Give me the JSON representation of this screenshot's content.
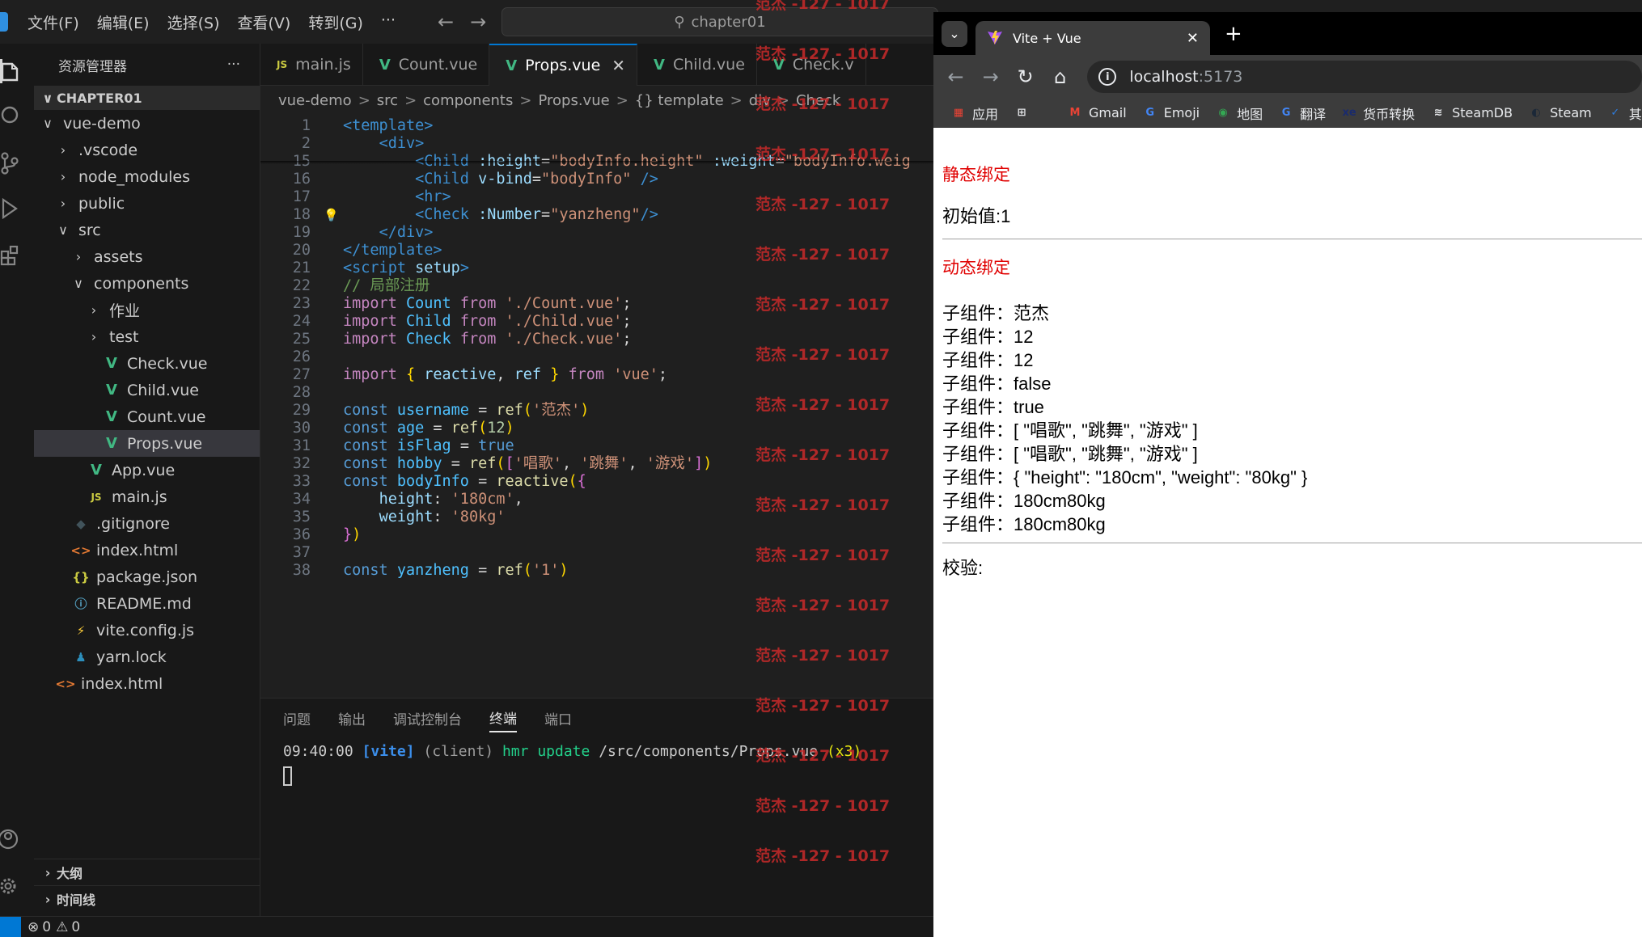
{
  "vscode": {
    "menu": [
      "文件(F)",
      "编辑(E)",
      "选择(S)",
      "查看(V)",
      "转到(G)",
      "···"
    ],
    "search_text": "chapter01",
    "explorer_title": "资源管理器",
    "explorer_more": "···",
    "section_title": "CHAPTER01",
    "tree": [
      {
        "label": "vue-demo",
        "chev": "∨",
        "indent": 0,
        "icon": "",
        "kind": "folder"
      },
      {
        "label": ".vscode",
        "chev": "›",
        "indent": 1,
        "icon": "",
        "kind": "folder"
      },
      {
        "label": "node_modules",
        "chev": "›",
        "indent": 1,
        "icon": "",
        "kind": "folder"
      },
      {
        "label": "public",
        "chev": "›",
        "indent": 1,
        "icon": "",
        "kind": "folder"
      },
      {
        "label": "src",
        "chev": "∨",
        "indent": 1,
        "icon": "",
        "kind": "folder"
      },
      {
        "label": "assets",
        "chev": "›",
        "indent": 2,
        "icon": "",
        "kind": "folder"
      },
      {
        "label": "components",
        "chev": "∨",
        "indent": 2,
        "icon": "",
        "kind": "folder"
      },
      {
        "label": "作业",
        "chev": "›",
        "indent": 3,
        "icon": "",
        "kind": "folder"
      },
      {
        "label": "test",
        "chev": "›",
        "indent": 3,
        "icon": "",
        "kind": "folder"
      },
      {
        "label": "Check.vue",
        "chev": "",
        "indent": 3,
        "icon": "V",
        "kind": "vue"
      },
      {
        "label": "Child.vue",
        "chev": "",
        "indent": 3,
        "icon": "V",
        "kind": "vue"
      },
      {
        "label": "Count.vue",
        "chev": "",
        "indent": 3,
        "icon": "V",
        "kind": "vue"
      },
      {
        "label": "Props.vue",
        "chev": "",
        "indent": 3,
        "icon": "V",
        "kind": "vue",
        "selected": true
      },
      {
        "label": "App.vue",
        "chev": "",
        "indent": 2,
        "icon": "V",
        "kind": "vue"
      },
      {
        "label": "main.js",
        "chev": "",
        "indent": 2,
        "icon": "JS",
        "kind": "js"
      },
      {
        "label": ".gitignore",
        "chev": "",
        "indent": 1,
        "icon": "◆",
        "kind": "git"
      },
      {
        "label": "index.html",
        "chev": "",
        "indent": 1,
        "icon": "<>",
        "kind": "html"
      },
      {
        "label": "package.json",
        "chev": "",
        "indent": 1,
        "icon": "{}",
        "kind": "json"
      },
      {
        "label": "README.md",
        "chev": "",
        "indent": 1,
        "icon": "ⓘ",
        "kind": "md"
      },
      {
        "label": "vite.config.js",
        "chev": "",
        "indent": 1,
        "icon": "⚡",
        "kind": "vite"
      },
      {
        "label": "yarn.lock",
        "chev": "",
        "indent": 1,
        "icon": "♟",
        "kind": "yarn"
      },
      {
        "label": "index.html",
        "chev": "",
        "indent": 0,
        "icon": "<>",
        "kind": "html"
      }
    ],
    "outline_label": "大纲",
    "timeline_label": "时间线",
    "tabs": [
      {
        "label": "main.js",
        "icon": "JS",
        "kind": "js"
      },
      {
        "label": "Count.vue",
        "icon": "V",
        "kind": "vue"
      },
      {
        "label": "Props.vue",
        "icon": "V",
        "kind": "vue",
        "active": true,
        "close": "✕"
      },
      {
        "label": "Child.vue",
        "icon": "V",
        "kind": "vue"
      },
      {
        "label": "Check.v",
        "icon": "V",
        "kind": "vue"
      }
    ],
    "breadcrumb": [
      "vue-demo",
      ">",
      "src",
      ">",
      "components",
      ">",
      "Props.vue",
      ">",
      "{} template",
      ">",
      "div",
      ">",
      "Check"
    ],
    "code_lines": [
      {
        "n": "1",
        "html": "<span class='tag'>&lt;template&gt;</span>"
      },
      {
        "n": "2",
        "html": "    <span class='tag'>&lt;div&gt;</span>"
      },
      {
        "n": "15",
        "html": "        <span class='tag'>&lt;Child</span> <span class='attr'>:height</span><span class='pl'>=</span><span class='str'>\"bodyInfo.height\"</span> <span class='attr'>:weight</span><span class='pl'>=</span><span class='str'>\"bodyInfo.weig</span>"
      },
      {
        "n": "16",
        "html": "        <span class='tag'>&lt;Child</span> <span class='attr'>v-bind</span><span class='pl'>=</span><span class='str'>\"bodyInfo\"</span> <span class='tag'>/&gt;</span>"
      },
      {
        "n": "17",
        "html": "        <span class='tag'>&lt;hr&gt;</span>"
      },
      {
        "n": "18",
        "html": "        <span class='tag'>&lt;Check</span> <span class='attr'>:Number</span><span class='pl'>=</span><span class='str'>\"yanzheng\"</span><span class='tag'>/&gt;</span>"
      },
      {
        "n": "19",
        "html": "    <span class='tag'>&lt;/div&gt;</span>"
      },
      {
        "n": "20",
        "html": "<span class='tag'>&lt;/template&gt;</span>"
      },
      {
        "n": "21",
        "html": "<span class='tag'>&lt;script</span> <span class='attr'>setup</span><span class='tag'>&gt;</span>"
      },
      {
        "n": "22",
        "html": "<span class='cmt'>// 局部注册</span>"
      },
      {
        "n": "23",
        "html": "<span class='kwc'>import</span> <span class='var'>Count</span> <span class='kwc'>from</span> <span class='str'>'./Count.vue'</span><span class='pl'>;</span>"
      },
      {
        "n": "24",
        "html": "<span class='kwc'>import</span> <span class='var'>Child</span> <span class='kwc'>from</span> <span class='str'>'./Child.vue'</span><span class='pl'>;</span>"
      },
      {
        "n": "25",
        "html": "<span class='kwc'>import</span> <span class='var'>Check</span> <span class='kwc'>from</span> <span class='str'>'./Check.vue'</span><span class='pl'>;</span>"
      },
      {
        "n": "26",
        "html": ""
      },
      {
        "n": "27",
        "html": "<span class='kwc'>import</span> <span class='br'>{</span> <span class='prop'>reactive</span><span class='pl'>,</span> <span class='prop'>ref</span> <span class='br'>}</span> <span class='kwc'>from</span> <span class='str'>'vue'</span><span class='pl'>;</span>"
      },
      {
        "n": "28",
        "html": ""
      },
      {
        "n": "29",
        "html": "<span class='kw'>const</span> <span class='var'>username</span> <span class='pl'>=</span> <span class='fn'>ref</span><span class='br'>(</span><span class='str'>'范杰'</span><span class='br'>)</span>"
      },
      {
        "n": "30",
        "html": "<span class='kw'>const</span> <span class='var'>age</span> <span class='pl'>=</span> <span class='fn'>ref</span><span class='br'>(</span><span class='num'>12</span><span class='br'>)</span>"
      },
      {
        "n": "31",
        "html": "<span class='kw'>const</span> <span class='var'>isFlag</span> <span class='pl'>=</span> <span class='kw'>true</span>"
      },
      {
        "n": "32",
        "html": "<span class='kw'>const</span> <span class='var'>hobby</span> <span class='pl'>=</span> <span class='fn'>ref</span><span class='br'>(</span><span class='br2'>[</span><span class='str'>'唱歌'</span><span class='pl'>,</span> <span class='str'>'跳舞'</span><span class='pl'>,</span> <span class='str'>'游戏'</span><span class='br2'>]</span><span class='br'>)</span>"
      },
      {
        "n": "33",
        "html": "<span class='kw'>const</span> <span class='var'>bodyInfo</span> <span class='pl'>=</span> <span class='fn'>reactive</span><span class='br'>(</span><span class='br2'>{</span>"
      },
      {
        "n": "34",
        "html": "    <span class='prop'>height</span><span class='pl'>:</span> <span class='str'>'180cm'</span><span class='pl'>,</span>"
      },
      {
        "n": "35",
        "html": "    <span class='prop'>weight</span><span class='pl'>:</span> <span class='str'>'80kg'</span>"
      },
      {
        "n": "36",
        "html": "<span class='br2'>}</span><span class='br'>)</span>"
      },
      {
        "n": "37",
        "html": ""
      },
      {
        "n": "38",
        "html": "<span class='kw'>const</span> <span class='var'>yanzheng</span> <span class='pl'>=</span> <span class='fn'>ref</span><span class='br'>(</span><span class='str'>'1'</span><span class='br'>)</span>"
      }
    ],
    "panel_tabs": [
      "问题",
      "输出",
      "调试控制台",
      "终端",
      "端口"
    ],
    "panel_active": 3,
    "terminal": {
      "time": "09:40:00",
      "vite": "[vite]",
      "client": "(client)",
      "hmr": "hmr update",
      "path": "/src/components/Props.vue",
      "count": "(x3)"
    },
    "status": {
      "errors": "0",
      "warnings": "0"
    },
    "watermark_text": "范杰 -127 - 1017"
  },
  "browser": {
    "tab_title": "Vite + Vue",
    "tab_close": "✕",
    "new_tab": "+",
    "url_host": "localhost",
    "url_port": ":5173",
    "bookmarks": [
      {
        "label": "应用",
        "icon": "▦",
        "color": "#ea4335"
      },
      {
        "label": "",
        "icon": "⊞",
        "color": "#e8eaed"
      },
      {
        "label": "Gmail",
        "icon": "M",
        "color": "#ea4335"
      },
      {
        "label": "Emoji",
        "icon": "G",
        "color": "#4285f4"
      },
      {
        "label": "地图",
        "icon": "◉",
        "color": "#34a853"
      },
      {
        "label": "翻译",
        "icon": "G",
        "color": "#4285f4"
      },
      {
        "label": "货币转换",
        "icon": "xe",
        "color": "#1a2b6d"
      },
      {
        "label": "SteamDB",
        "icon": "≋",
        "color": "#e8eaed"
      },
      {
        "label": "Steam",
        "icon": "◐",
        "color": "#1b2838"
      },
      {
        "label": "其乐 K",
        "icon": "✓",
        "color": "#2d7de0"
      }
    ],
    "page": {
      "static_heading": "静态绑定",
      "initial_value": "初始值:1",
      "dynamic_heading": "动态绑定",
      "child_lines": [
        "子组件：范杰",
        "子组件：12",
        "子组件：12",
        "子组件：false",
        "子组件：true",
        "子组件：[ \"唱歌\", \"跳舞\", \"游戏\" ]",
        "子组件：[ \"唱歌\", \"跳舞\", \"游戏\" ]",
        "子组件：{ \"height\": \"180cm\", \"weight\": \"80kg\" }",
        "子组件：180cm80kg",
        "子组件：180cm80kg"
      ],
      "check_label": "校验:"
    }
  }
}
